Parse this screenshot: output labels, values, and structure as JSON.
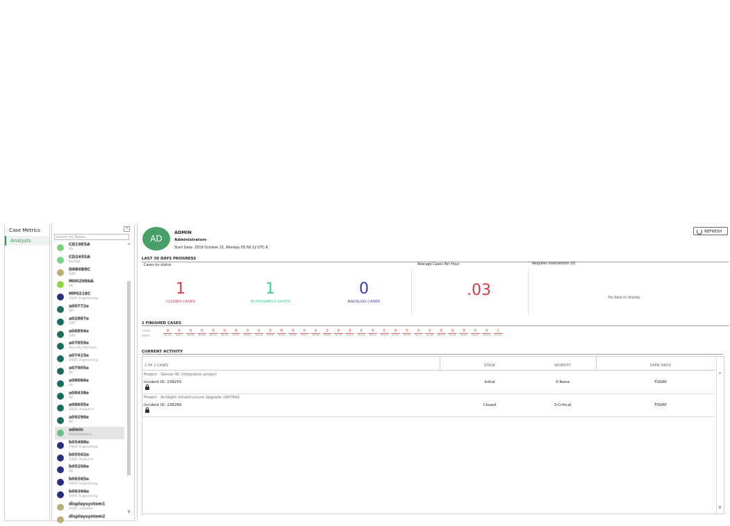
{
  "nav": {
    "items": [
      {
        "label": "Case Metrics",
        "active": false
      },
      {
        "label": "Analysts",
        "active": true
      }
    ]
  },
  "analysts": {
    "search_placeholder": "Search by Name...",
    "collapse_symbol": "«",
    "scroll_up": "^",
    "scroll_down": "v",
    "list": [
      {
        "name": "CD19E5A",
        "role": "US",
        "color": "#7ccf87"
      },
      {
        "name": "CD2455A",
        "role": "SecOps",
        "color": "#7ccf87"
      },
      {
        "name": "D8B6B8C",
        "role": "CIRT",
        "color": "#b8b07a"
      },
      {
        "name": "M002986A",
        "role": "US",
        "color": "#8fd24a"
      },
      {
        "name": "MP0218C",
        "role": "GSOC Engineering",
        "color": "#2b2f7a"
      },
      {
        "name": "a00772e",
        "role": "DE",
        "color": "#1d6b5c"
      },
      {
        "name": "a02887e",
        "role": "CIRT",
        "color": "#1d6b5c"
      },
      {
        "name": "a06894e",
        "role": "CIRT",
        "color": "#1d6b5c"
      },
      {
        "name": "a07859e",
        "role": "Security Administ...",
        "color": "#1d6b5c"
      },
      {
        "name": "a07415e",
        "role": "GSOC Engineering",
        "color": "#1d6b5c"
      },
      {
        "name": "a07905e",
        "role": "DE",
        "color": "#1d6b5c"
      },
      {
        "name": "a08066e",
        "role": "US",
        "color": "#1d6b5c"
      },
      {
        "name": "a08438e",
        "role": "DE",
        "color": "#1d6b5c"
      },
      {
        "name": "a08695e",
        "role": "GSOC Analyst II",
        "color": "#1d6b5c"
      },
      {
        "name": "a09290e",
        "role": "DE",
        "color": "#1d6b5c"
      },
      {
        "name": "admin",
        "role": "Administrators",
        "color": "#6dbb86",
        "selected": true
      },
      {
        "name": "b05488e",
        "role": "GSOC Engineering",
        "color": "#2b2f7a"
      },
      {
        "name": "b05502e",
        "role": "GSOC Analyst II",
        "color": "#2b2f7a"
      },
      {
        "name": "b05206e",
        "role": "DE",
        "color": "#2b2f7a"
      },
      {
        "name": "b06365e",
        "role": "GSOC Engineering",
        "color": "#2b2f7a"
      },
      {
        "name": "b06366e",
        "role": "GSOC Engineering",
        "color": "#2b2f7a"
      },
      {
        "name": "displaysystem1",
        "role": "GSOC Consoles",
        "color": "#b8b07a"
      },
      {
        "name": "displaysystem2",
        "role": "",
        "color": "#b8b07a"
      }
    ]
  },
  "profile": {
    "initials": "AD",
    "name": "ADMIN",
    "group": "Administrators",
    "start_date": "Start Date: 2019 October 21, Monday 05:58:12 UTC-6",
    "refresh_label": "REFRESH"
  },
  "progress": {
    "heading": "LAST 30 DAYS PROGRESS",
    "cases_by_status_label": "Cases by status",
    "closed": {
      "value": "1",
      "label": "CLOSED CASES",
      "color": "#d33a4a"
    },
    "in_progress": {
      "value": "1",
      "label": "IN PROGRESS CASES",
      "color": "#3ccf8e"
    },
    "backlog": {
      "value": "0",
      "label": "BACKLOG CASES",
      "color": "#3b3bb0"
    },
    "avg_label": "Average Cases Per Hour",
    "avg_value": ".03",
    "avg_color": "#d33a4a",
    "requires_label": "Requires intervention (0)",
    "requires_empty": "No data to display"
  },
  "finished": {
    "heading": "1 FINISHED CASES",
    "legend": [
      "cases",
      "dates"
    ],
    "days": [
      {
        "v": "0",
        "d": "8/26"
      },
      {
        "v": "0",
        "d": "8/27"
      },
      {
        "v": "0",
        "d": "8/28"
      },
      {
        "v": "0",
        "d": "8/29"
      },
      {
        "v": "0",
        "d": "8/30"
      },
      {
        "v": "0",
        "d": "8/31"
      },
      {
        "v": "0",
        "d": "9/01"
      },
      {
        "v": "0",
        "d": "9/02"
      },
      {
        "v": "0",
        "d": "9/03"
      },
      {
        "v": "0",
        "d": "9/04"
      },
      {
        "v": "0",
        "d": "9/05"
      },
      {
        "v": "0",
        "d": "9/06"
      },
      {
        "v": "0",
        "d": "9/07"
      },
      {
        "v": "0",
        "d": "9/08"
      },
      {
        "v": "0",
        "d": "9/09"
      },
      {
        "v": "0",
        "d": "9/10"
      },
      {
        "v": "0",
        "d": "9/11"
      },
      {
        "v": "0",
        "d": "9/12"
      },
      {
        "v": "0",
        "d": "9/13"
      },
      {
        "v": "0",
        "d": "9/14"
      },
      {
        "v": "0",
        "d": "9/15"
      },
      {
        "v": "0",
        "d": "9/16"
      },
      {
        "v": "0",
        "d": "9/17"
      },
      {
        "v": "0",
        "d": "9/18"
      },
      {
        "v": "0",
        "d": "9/19"
      },
      {
        "v": "0",
        "d": "9/20"
      },
      {
        "v": "0",
        "d": "9/21"
      },
      {
        "v": "0",
        "d": "9/22"
      },
      {
        "v": "0",
        "d": "9/23"
      },
      {
        "v": "1",
        "d": "9/24"
      }
    ]
  },
  "activity": {
    "heading": "CURRENT ACTIVITY",
    "count_label": "2 OF 2 CASES",
    "columns": {
      "stage": "STAGE",
      "severity": "SEVERITY",
      "open_since": "OPEN SINCE"
    },
    "rows": [
      {
        "title": "Project - Sensor RC integration project",
        "incident": "Incident ID: 238255",
        "stage": "Initial",
        "severity": "0-None",
        "open_since": "TODAY"
      },
      {
        "title": "Project - ArcSight Infrastructure Upgrade 2407642",
        "incident": "Incident ID: 238260",
        "stage": "Closed",
        "severity": "3-Critical",
        "open_since": "TODAY"
      }
    ]
  }
}
